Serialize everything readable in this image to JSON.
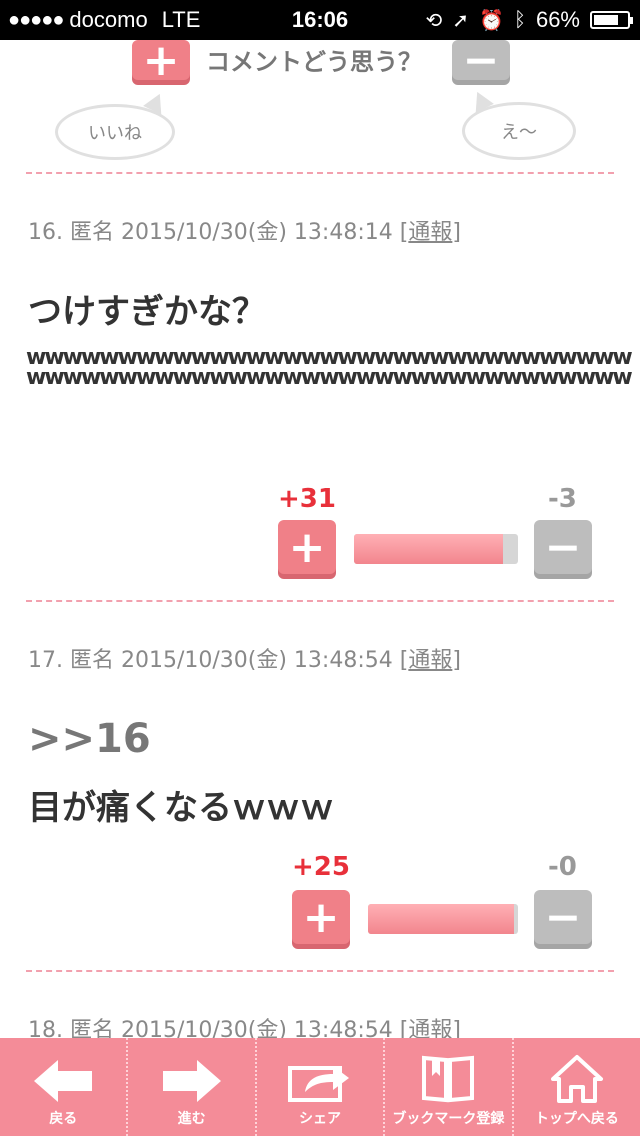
{
  "status_bar": {
    "signal": "●●●●●",
    "carrier": "docomo",
    "network": "LTE",
    "time": "16:06",
    "battery": "66%"
  },
  "top_vote": {
    "plus_symbol": "+",
    "minus_symbol": "−",
    "question": "コメントどう思う？",
    "like_bubble": "いいね",
    "eh_bubble": "え〜"
  },
  "comments": [
    {
      "meta": "16. 匿名 2015/10/30(金) 13:48:14",
      "report": "通報",
      "title": "つけすぎかな？",
      "body": "wwwwwwwwwwwwwwwwwwwwwwwwwwwwwwwwwwwwwwwwwwwwwwwwwwwwwwwwwwwwwwwwwwwwwwwwwwwwwwwwwwwwwwwwwwwwwwwwwwwwwwwwwww",
      "plus_count": "+31",
      "minus_count": "-3",
      "plus_ratio": 0.91
    },
    {
      "meta": "17. 匿名 2015/10/30(金) 13:48:54",
      "report": "通報",
      "reply": ">>16",
      "title": "目が痛くなるｗｗｗ",
      "plus_count": "+25",
      "minus_count": "-0",
      "plus_ratio": 0.97
    },
    {
      "meta": "18. 匿名 2015/10/30(金) 13:48:54",
      "report": "通報"
    }
  ],
  "bracket_open": "[",
  "bracket_close": "]",
  "toolbar": {
    "back": "戻る",
    "forward": "進む",
    "share": "シェア",
    "bookmark": "ブックマーク登録",
    "top": "トップへ戻る"
  },
  "colors": {
    "accent": "#f08088",
    "toolbar": "#f48c98",
    "plus_count": "#e8303a"
  }
}
